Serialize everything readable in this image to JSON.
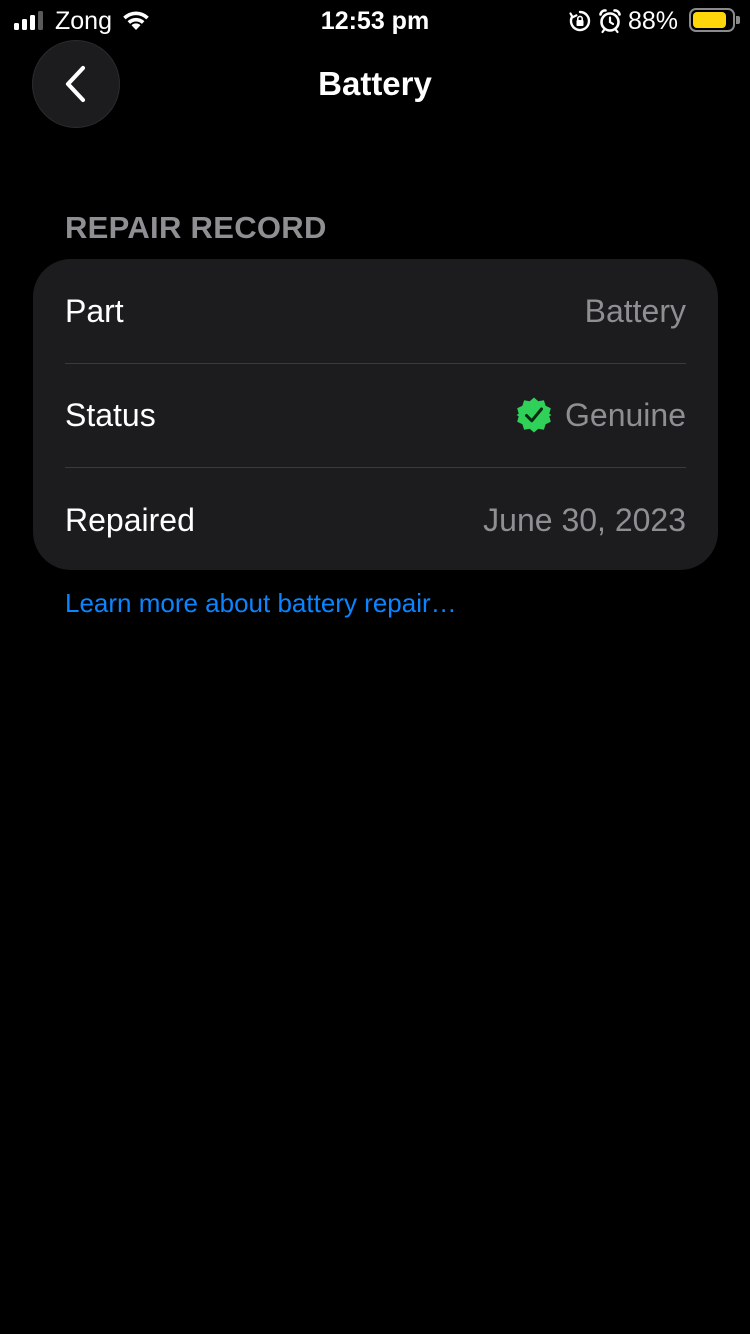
{
  "status_bar": {
    "carrier": "Zong",
    "time": "12:53 pm",
    "battery_percent": "88%",
    "battery_level": 0.88,
    "signal_bars_active": 3,
    "signal_bars_total": 4,
    "battery_color": "#ffd60a"
  },
  "nav": {
    "title": "Battery",
    "back_icon": "chevron-left-icon"
  },
  "section": {
    "header": "REPAIR RECORD"
  },
  "repair_record": {
    "rows": [
      {
        "label": "Part",
        "value": "Battery"
      },
      {
        "label": "Status",
        "value": "Genuine",
        "icon": "verified-badge-icon",
        "icon_color": "#30d158"
      },
      {
        "label": "Repaired",
        "value": "June 30, 2023"
      }
    ]
  },
  "link": {
    "text": "Learn more about battery repair…",
    "color": "#0a84ff"
  }
}
